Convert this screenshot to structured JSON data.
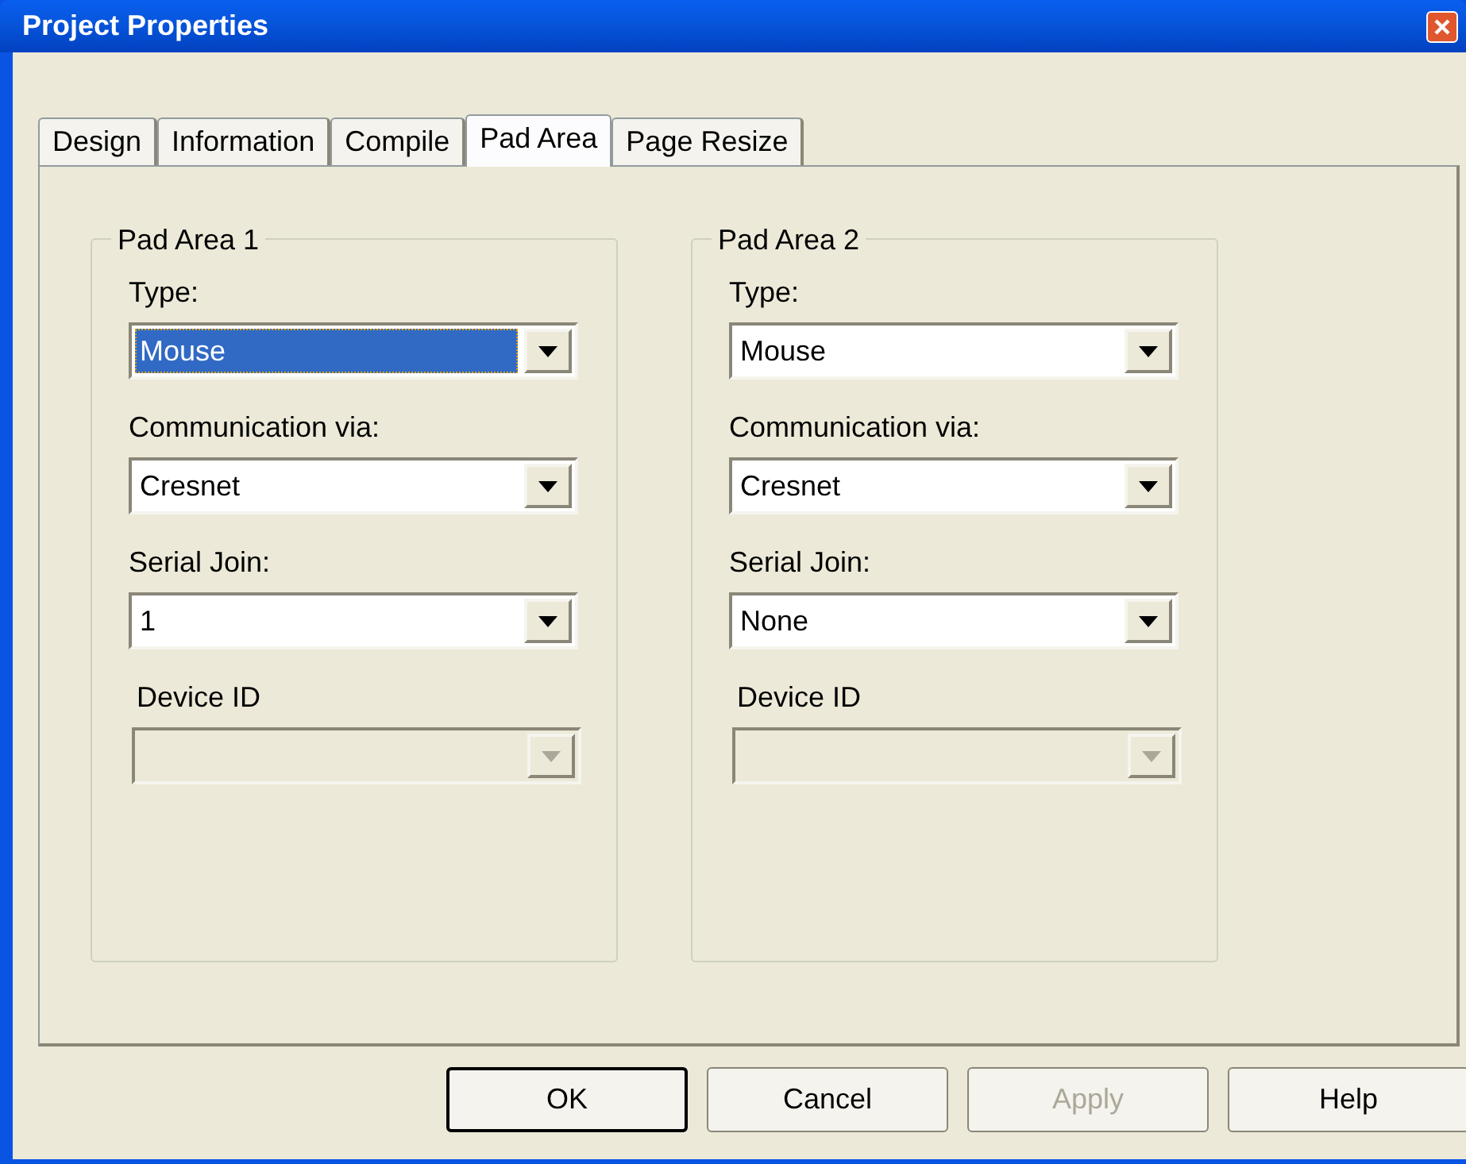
{
  "window": {
    "title": "Project Properties"
  },
  "tabs": [
    {
      "label": "Design",
      "selected": false
    },
    {
      "label": "Information",
      "selected": false
    },
    {
      "label": "Compile",
      "selected": false
    },
    {
      "label": "Pad Area",
      "selected": true
    },
    {
      "label": "Page Resize",
      "selected": false
    }
  ],
  "groups": [
    {
      "title": "Pad Area 1",
      "fields": [
        {
          "label": "Type:",
          "value": "Mouse",
          "highlighted": true,
          "disabled": false
        },
        {
          "label": "Communication via:",
          "value": "Cresnet",
          "highlighted": false,
          "disabled": false
        },
        {
          "label": "Serial Join:",
          "value": "1",
          "highlighted": false,
          "disabled": false
        },
        {
          "label": "Device ID",
          "disabled": true
        }
      ]
    },
    {
      "title": "Pad Area 2",
      "fields": [
        {
          "label": "Type:",
          "value": "Mouse",
          "highlighted": false,
          "disabled": false
        },
        {
          "label": "Communication via:",
          "value": "Cresnet",
          "highlighted": false,
          "disabled": false
        },
        {
          "label": "Serial Join:",
          "value": "None",
          "highlighted": false,
          "disabled": false
        },
        {
          "label": "Device ID",
          "disabled": true
        }
      ]
    }
  ],
  "buttons": [
    {
      "label": "OK",
      "default": true,
      "disabled": false
    },
    {
      "label": "Cancel",
      "default": false,
      "disabled": false
    },
    {
      "label": "Apply",
      "default": false,
      "disabled": true
    },
    {
      "label": "Help",
      "default": false,
      "disabled": false
    }
  ]
}
